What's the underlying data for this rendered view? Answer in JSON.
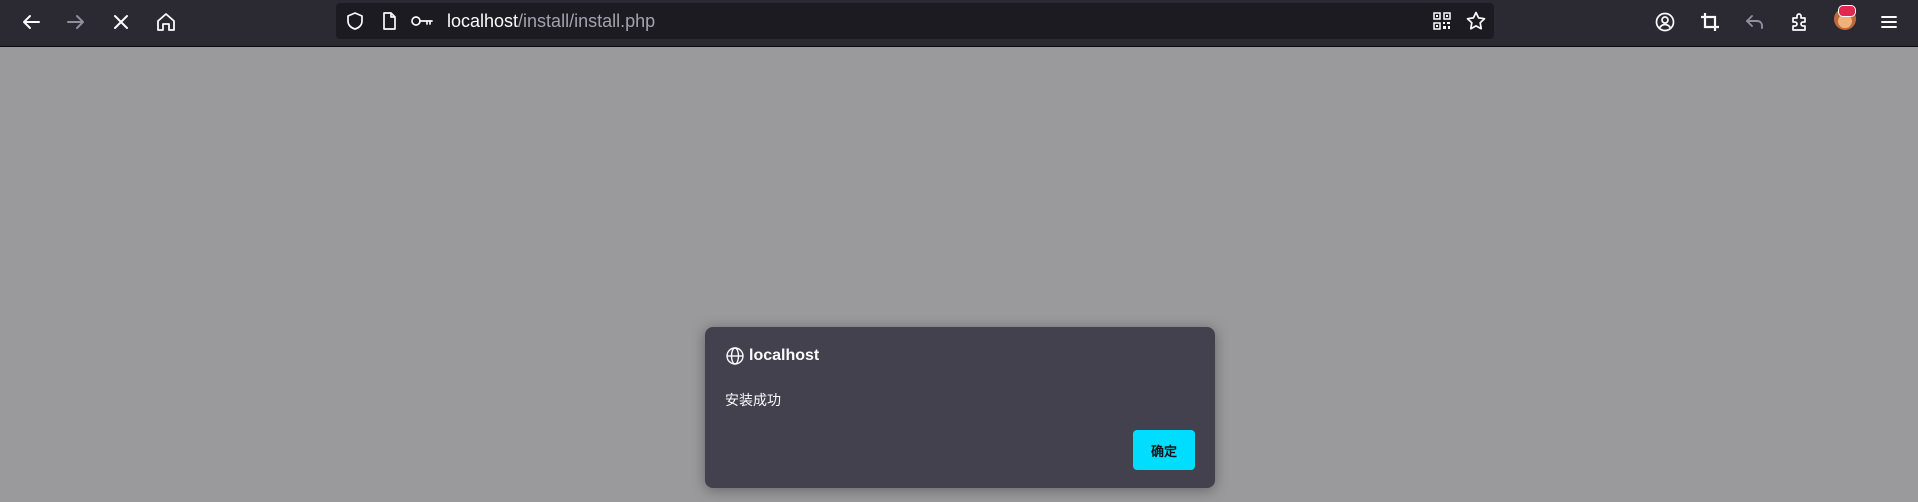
{
  "browser": {
    "url": {
      "host": "localhost",
      "path": "/install/install.php"
    },
    "icons": {
      "back": "arrow-left-icon",
      "forward": "arrow-right-icon",
      "stop": "close-icon",
      "home": "home-icon",
      "tracking": "shield-icon",
      "page_info": "page-icon",
      "permissions": "key-icon",
      "qr": "qr-code-icon",
      "bookmark": "star-icon",
      "account": "account-icon",
      "screenshot": "crop-icon",
      "undo": "undo-icon",
      "extensions": "puzzle-icon",
      "profile": "avatar-icon",
      "menu": "hamburger-menu-icon"
    }
  },
  "dialog": {
    "title": "localhost",
    "message": "安装成功",
    "ok_label": "确定",
    "accent": "#00ddff"
  },
  "colors": {
    "toolbar": "#2b2a33",
    "urlbar": "#1c1b22",
    "backdrop": "#9a9a9c",
    "dialog": "#42414d"
  }
}
